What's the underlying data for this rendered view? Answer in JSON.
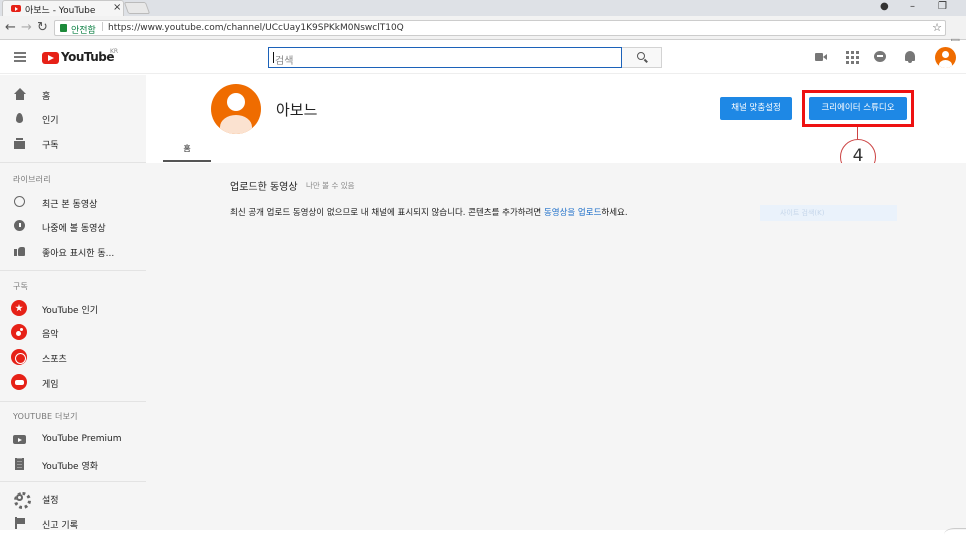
{
  "browser": {
    "tab_title": "아보느 - YouTube",
    "tab_close": "×",
    "secure_label": "안전함",
    "url": "https://www.youtube.com/channel/UCcUay1K9SPKkM0NswclT10Q",
    "window_controls": [
      "●",
      "–",
      "❐"
    ]
  },
  "masthead": {
    "logo_text": "YouTube",
    "region": "KR",
    "search_placeholder": "검색"
  },
  "sidebar": {
    "main_items": [
      {
        "label": "홈",
        "icon": "home-icon"
      },
      {
        "label": "인기",
        "icon": "trending-icon"
      },
      {
        "label": "구독",
        "icon": "subscriptions-icon"
      }
    ],
    "library_header": "라이브러리",
    "library_items": [
      {
        "label": "최근 본 동영상",
        "icon": "history-icon"
      },
      {
        "label": "나중에 볼 동영상",
        "icon": "watch-later-icon"
      },
      {
        "label": "좋아요 표시한 동...",
        "icon": "like-icon"
      }
    ],
    "subs_header": "구독",
    "subs_items": [
      {
        "label": "YouTube 인기",
        "icon": "star-icon"
      },
      {
        "label": "음악",
        "icon": "music-icon"
      },
      {
        "label": "스포츠",
        "icon": "sports-icon"
      },
      {
        "label": "게임",
        "icon": "gaming-icon"
      }
    ],
    "more_header": "YOUTUBE 더보기",
    "more_items": [
      {
        "label": "YouTube Premium",
        "icon": "premium-icon"
      },
      {
        "label": "YouTube 영화",
        "icon": "film-icon"
      }
    ],
    "bottom_items": [
      {
        "label": "설정",
        "icon": "gear-icon"
      },
      {
        "label": "신고 기록",
        "icon": "flag-icon"
      }
    ]
  },
  "channel": {
    "name": "아보느",
    "customize_button": "채널 맞춤설정",
    "studio_button": "크리에이터 스튜디오",
    "callout_number": "4",
    "tab_home": "홈"
  },
  "content": {
    "section_title": "업로드한 동영상",
    "section_sub": "나만 볼 수 있음",
    "empty_before": "최신 공개 업로드 동영상이 없으므로 내 채널에 표시되지 않습니다. 콘텐츠를 추가하려면 ",
    "empty_link": "동영상을 업로드",
    "empty_after": "하세요.",
    "ghost_text": "사이트 검색(K)"
  },
  "colors": {
    "accent_blue": "#1e88e5",
    "youtube_red": "#e62117",
    "highlight_red": "#e11111",
    "avatar_orange": "#ef6c00"
  }
}
